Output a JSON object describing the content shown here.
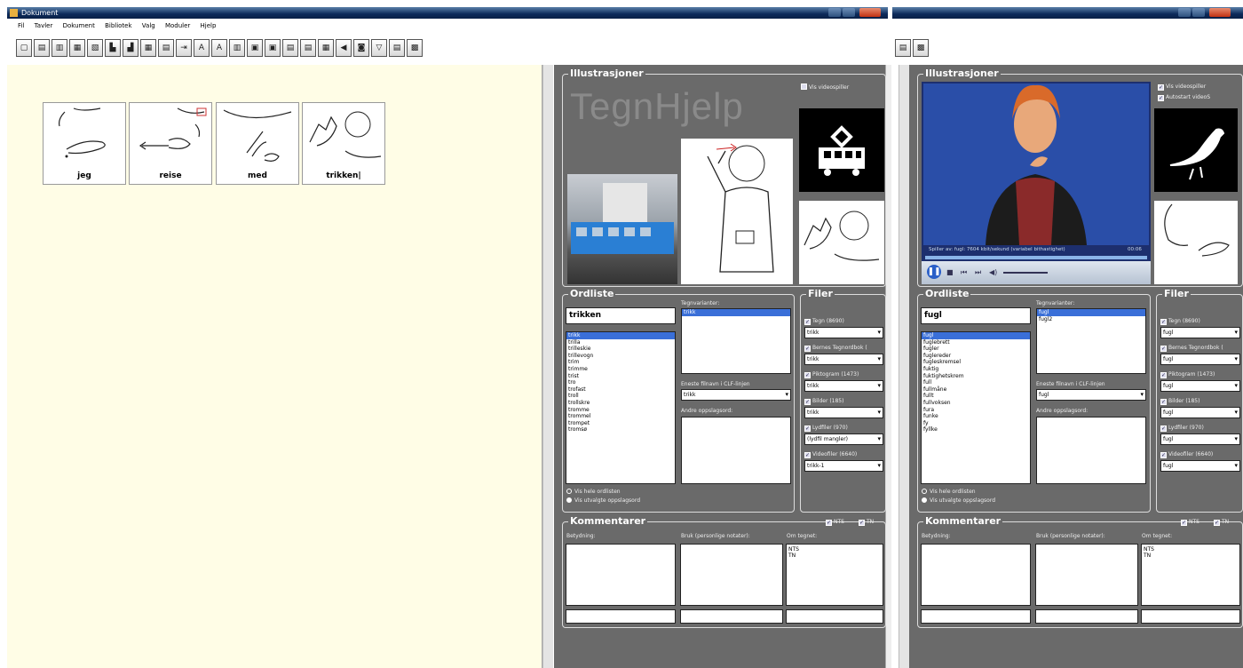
{
  "left_window": {
    "title": "Dokument",
    "menu": [
      "Fil",
      "Tavler",
      "Dokument",
      "Bibliotek",
      "Valg",
      "Moduler",
      "Hjelp"
    ],
    "cards": [
      {
        "label": "jeg"
      },
      {
        "label": "reise"
      },
      {
        "label": "med"
      },
      {
        "label": "trikken|"
      }
    ]
  },
  "panel1": {
    "illustrations_title": "Illustrasjoner",
    "logo_text": "TegnHjelp",
    "show_video_label": "Vis videospiller",
    "tram_photo_label": "trikk",
    "wordlist_title": "Ordliste",
    "search_value": "trikken",
    "sign_variants_label": "Tegnvarianter:",
    "sign_variants": [
      "trikk"
    ],
    "words": [
      "trikk",
      "trilla",
      "trilleskie",
      "trillevogn",
      "trim",
      "trimme",
      "trist",
      "tro",
      "trofast",
      "troll",
      "trollskre",
      "tromme",
      "trommel",
      "trompet",
      "tromsø"
    ],
    "only_form_label": "Eneste filnavn i CLF-linjen",
    "only_form_value": "trikk",
    "other_entry_label": "Andre oppslagsord:",
    "show_all_label": "Vis hele ordlisten",
    "show_selected_label": "Vis utvalgte oppslagsord",
    "files_title": "Filer",
    "files": [
      {
        "label": "Tegn (8690)",
        "value": "trikk"
      },
      {
        "label": "Bernes Tegnordbok (",
        "value": "trikk"
      },
      {
        "label": "Piktogram (1473)",
        "value": "trikk"
      },
      {
        "label": "Bilder (185)",
        "value": "trikk"
      },
      {
        "label": "Lydfiler (970)",
        "value": "(lydfil mangler)"
      },
      {
        "label": "Videofiler (6640)",
        "value": "trikk-1"
      }
    ],
    "comments_title": "Kommentarer",
    "nts_label": "NTS",
    "tn_label": "TN",
    "meaning_label": "Betydning:",
    "usage_label": "Bruk (personlige notater):",
    "about_sign_label": "Om tegnet:",
    "about_sign_text": [
      "NTS",
      "TN"
    ]
  },
  "panel2": {
    "illustrations_title": "Illustrasjoner",
    "show_video_label": "Vis videospiller",
    "autostart_label": "Autostart videoS",
    "video_status": "Spiller av: fugl: 7604 kbit/sekund (variabel bithastighet)",
    "video_time": "00:06",
    "wordlist_title": "Ordliste",
    "search_value": "fugl",
    "sign_variants_label": "Tegnvarianter:",
    "sign_variants": [
      "fugl",
      "fugl2"
    ],
    "words": [
      "fugl",
      "fuglebrett",
      "fugler",
      "fuglereder",
      "fugleskremsel",
      "fuktig",
      "fuktighetskrem",
      "full",
      "fullmåne",
      "fullt",
      "fullvoksen",
      "fura",
      "funke",
      "fy",
      "fyllke"
    ],
    "only_form_label": "Eneste filnavn i CLF-linjen",
    "only_form_value": "fugl",
    "other_entry_label": "Andre oppslagsord:",
    "show_all_label": "Vis hele ordlisten",
    "show_selected_label": "Vis utvalgte oppslagsord",
    "files_title": "Filer",
    "files": [
      {
        "label": "Tegn (8690)",
        "value": "fugl"
      },
      {
        "label": "Bernes Tegnordbok (",
        "value": "fugl"
      },
      {
        "label": "Piktogram (1473)",
        "value": "fugl"
      },
      {
        "label": "Bilder (185)",
        "value": "fugl"
      },
      {
        "label": "Lydfiler (970)",
        "value": "fugl"
      },
      {
        "label": "Videofiler (6640)",
        "value": "fugl"
      }
    ],
    "comments_title": "Kommentarer",
    "nts_label": "NTS",
    "tn_label": "TN",
    "meaning_label": "Betydning:",
    "usage_label": "Bruk (personlige notater):",
    "about_sign_label": "Om tegnet:",
    "about_sign_text": [
      "NTS",
      "TN"
    ]
  }
}
